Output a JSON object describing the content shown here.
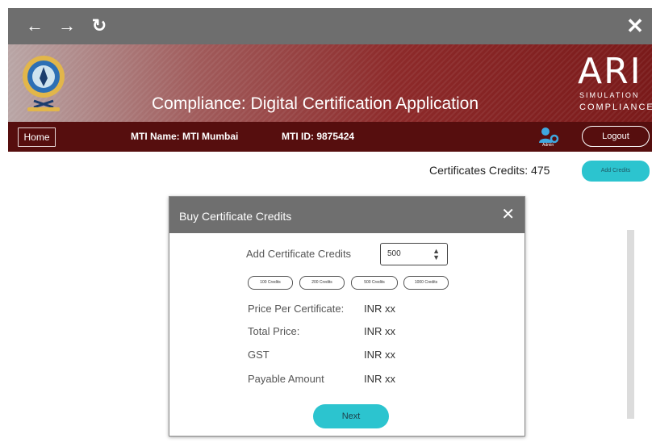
{
  "browser": {
    "back_icon": "arrow-left-icon",
    "forward_icon": "arrow-right-icon",
    "reload_icon": "reload-icon",
    "close_icon": "close-icon",
    "back_glyph": "←",
    "forward_glyph": "→",
    "reload_glyph": "↻",
    "close_glyph": "✕"
  },
  "header": {
    "title": "Compliance: Digital Certification Application",
    "brand_big": "ARI",
    "brand_simulation": "SIMULATION",
    "brand_compliance": "COMPLIANCE"
  },
  "navbar": {
    "home_label": "Home",
    "mti_name": "MTI Name: MTI Mumbai",
    "mti_id": "MTI ID: 9875424",
    "admin_label": "Admin",
    "logout_label": "Logout"
  },
  "credits": {
    "label": "Certificates Credits: 475",
    "add_button": "Add Credits"
  },
  "modal": {
    "title": "Buy Certificate Credits",
    "close_glyph": "✕",
    "add_label": "Add Certificate Credits",
    "quantity_value": "500",
    "presets": [
      "100 Credits",
      "200 Credits",
      "500 Credits",
      "1000 Credits"
    ],
    "rows": [
      {
        "label": "Price Per Certificate:",
        "value": "INR xx"
      },
      {
        "label": "Total Price:",
        "value": "INR xx"
      },
      {
        "label": "GST",
        "value": "INR xx"
      },
      {
        "label": "Payable Amount",
        "value": "INR xx"
      }
    ],
    "next_label": "Next"
  },
  "colors": {
    "browser_bar": "#6e6e6e",
    "navbar": "#560e0e",
    "header_dark": "#7a1a1a",
    "accent_teal": "#2cc4cf"
  }
}
